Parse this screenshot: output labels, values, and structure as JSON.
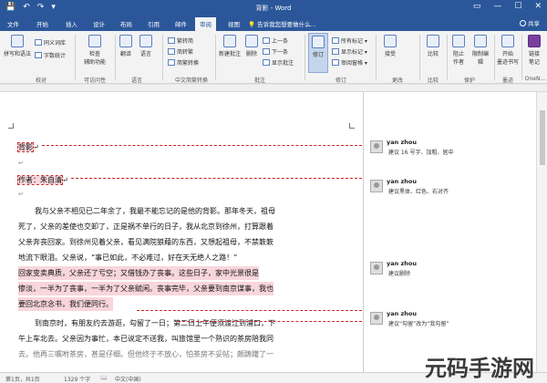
{
  "titlebar": {
    "quick_access": [
      "💾",
      "↶",
      "↷",
      "▾"
    ],
    "title": "背影 - Word",
    "window_buttons": [
      "▭",
      "—",
      "☐",
      "✕"
    ]
  },
  "tabs": [
    {
      "label": "文件"
    },
    {
      "label": "开始"
    },
    {
      "label": "插入"
    },
    {
      "label": "设计"
    },
    {
      "label": "布局"
    },
    {
      "label": "引用"
    },
    {
      "label": "邮件"
    },
    {
      "label": "审阅"
    },
    {
      "label": "视图"
    }
  ],
  "active_tab": "审阅",
  "tell_me": "告诉我您想要做什么...",
  "share_label": "共享",
  "ribbon": {
    "proofing": {
      "spell": "拼写和语法",
      "thesaurus": "同义词库",
      "wordcount": "字数统计",
      "group": "校对"
    },
    "accessibility": {
      "check": "检查",
      "check2": "辅助功能",
      "group": "可访问性"
    },
    "translate": {
      "translate": "翻译",
      "language": "语言",
      "group": "语言"
    },
    "chinese": {
      "t2s": "繁转简",
      "s2t": "简转繁",
      "conv": "简繁转换",
      "group": "中文简繁转换"
    },
    "comments": {
      "new": "新建批注",
      "delete": "删除",
      "prev": "上一条",
      "next": "下一条",
      "show": "显示批注",
      "group": "批注"
    },
    "tracking": {
      "track": "修订",
      "markup_select": "所有标记",
      "show_markup": "显示标记",
      "pane": "审阅窗格",
      "group": "修订"
    },
    "changes": {
      "accept": "接受",
      "group": "更改"
    },
    "compare": {
      "compare": "比较",
      "group": "比较"
    },
    "protect": {
      "block": "阻止",
      "block2": "作者",
      "restrict": "限制编辑",
      "group": "保护"
    },
    "ink": {
      "start": "开始",
      "start2": "墨迹书写",
      "group": "墨迹"
    },
    "onenote": {
      "linked": "链接",
      "linked2": "笔记",
      "group": "OneN..."
    }
  },
  "document": {
    "paragraph_mark": "↵",
    "title": "背影",
    "author": "作者：朱自清",
    "paragraphs": [
      [
        "我与父亲不相见已二年余了，我最不能忘记的是他的背影。那年冬天，祖母",
        "死了，父亲的差使也交卸了，正是祸不单行的日子，我从北京到徐州，打算跟着",
        "父亲奔丧回家。到徐州见着父亲，看见满院狼藉的东西，又想起祖母，不禁簌簌",
        "地流下眼泪。父亲说，“事已如此，不必难过，好在天无绝人之路！”"
      ],
      [
        "回家变卖典质，父亲还了亏空；又借钱办了丧事。这些日子，家中光景很是",
        "惨淡，一半为了丧事，一半为了父亲赋闲。丧事完毕，父亲要到南京谋事，我也",
        "要回北京念书，我们便同行。"
      ],
      [
        "到南京时，有朋友约去游逛，勾留了一日；第二日上午便须渡江到浦口，下",
        "午上车北去。父亲因为事忙，本已说定不送我，叫旅馆里一个熟识的茶房陪我同",
        "去。他再三嘱咐茶房，甚是仔细。但他终于不放心，怕茶房不妥帖；颇踌躇了一"
      ]
    ]
  },
  "comments": [
    {
      "author": "yan zhou",
      "text": "建议 16 号字、加粗、居中"
    },
    {
      "author": "yan zhou",
      "text": "建议黑体、红色、右对齐"
    },
    {
      "author": "yan zhou",
      "text": "建议删除"
    },
    {
      "author": "yan zhou",
      "text": "建议“勾留”改为“我勾留”"
    }
  ],
  "statusbar": {
    "page": "第1页，共1页",
    "words": "1329 个字",
    "lang": "中文(中国)"
  },
  "watermark": "元码手游网",
  "colors": {
    "word_blue": "#2b579a",
    "revision_red": "#c22222",
    "highlight": "#f8d6dc"
  }
}
